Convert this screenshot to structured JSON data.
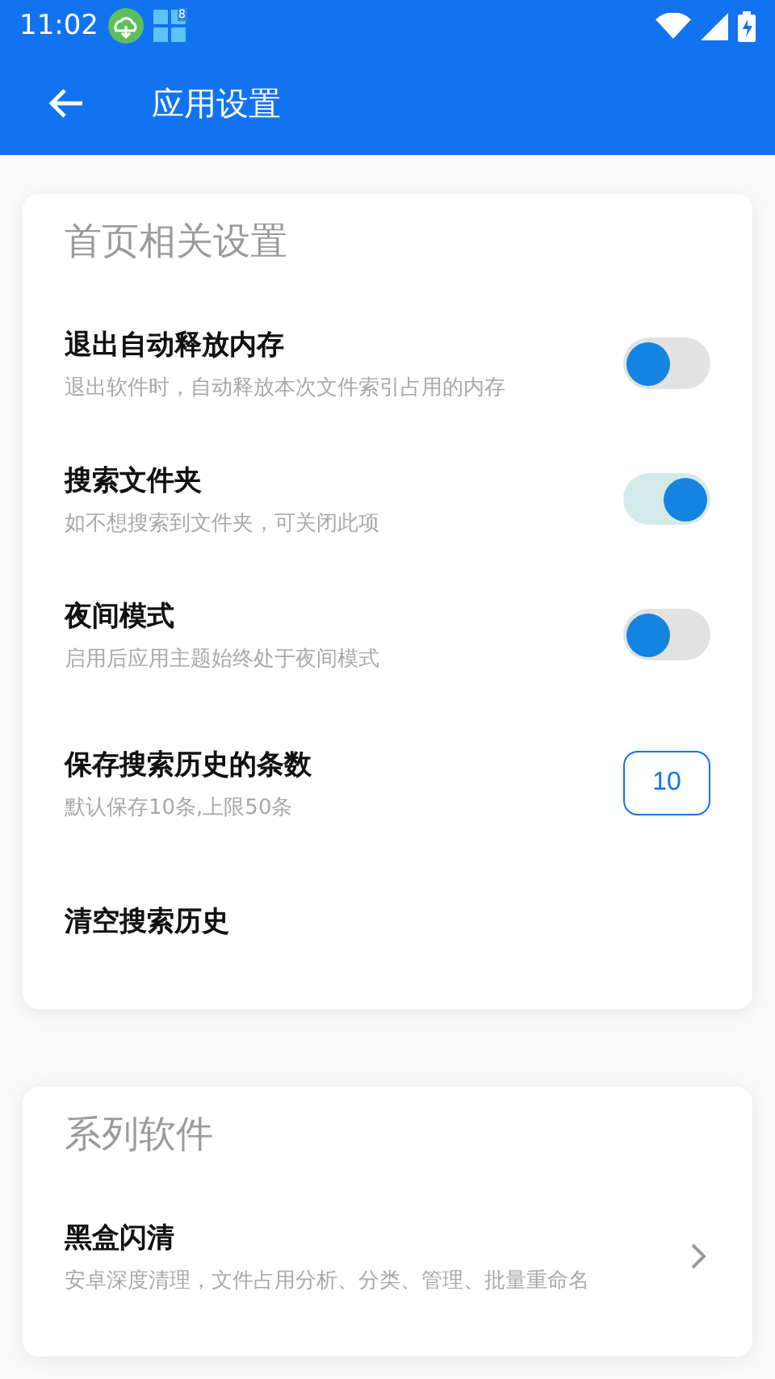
{
  "status_bar": {
    "time": "11:02",
    "app_badge": "8"
  },
  "app_bar": {
    "title": "应用设置"
  },
  "sections": [
    {
      "title": "首页相关设置",
      "items": [
        {
          "kind": "switch",
          "title": "退出自动释放内存",
          "subtitle": "退出软件时，自动释放本次文件索引占用的内存",
          "on": false
        },
        {
          "kind": "switch",
          "title": "搜索文件夹",
          "subtitle": "如不想搜索到文件夹，可关闭此项",
          "on": true
        },
        {
          "kind": "switch",
          "title": "夜间模式",
          "subtitle": "启用后应用主题始终处于夜间模式",
          "on": false
        },
        {
          "kind": "number",
          "title": "保存搜索历史的条数",
          "subtitle": "默认保存10条,上限50条",
          "value": "10"
        },
        {
          "kind": "action",
          "title": "清空搜索历史"
        }
      ]
    },
    {
      "title": "系列软件",
      "items": [
        {
          "kind": "link",
          "title": "黑盒闪清",
          "subtitle": "安卓深度清理，文件占用分析、分类、管理、批量重命名"
        }
      ]
    }
  ]
}
